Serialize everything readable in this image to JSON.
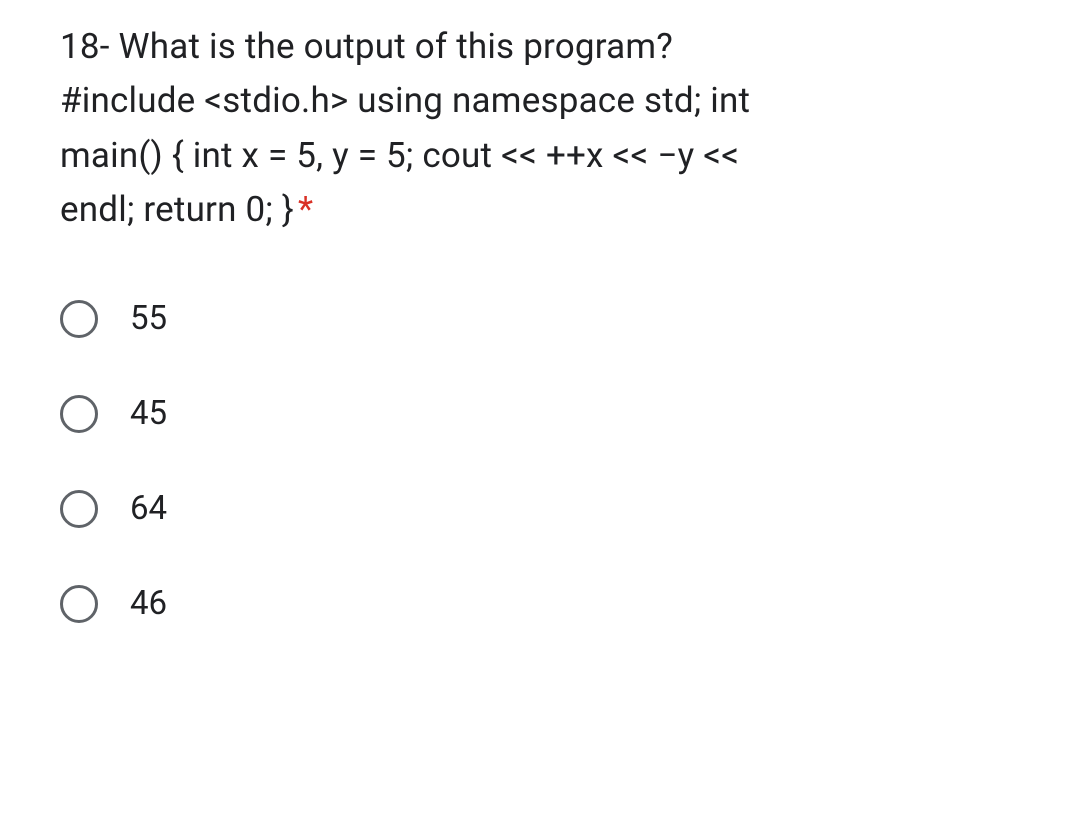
{
  "question": {
    "line1": "18- What is the output of this program?",
    "line2": "#include <stdio.h> using namespace std; int",
    "line3": "main() { int x = 5, y = 5; cout << ++x << −y <<",
    "line4": "endl; return 0; }",
    "required_marker": "*"
  },
  "options": [
    {
      "label": "55"
    },
    {
      "label": "45"
    },
    {
      "label": "64"
    },
    {
      "label": "46"
    }
  ]
}
